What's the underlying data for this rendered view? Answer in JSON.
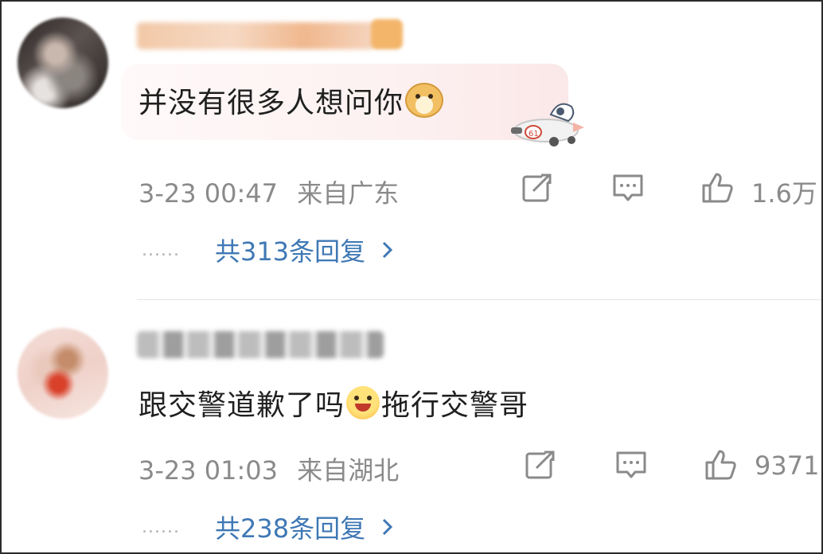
{
  "comments": [
    {
      "text": "并没有很多人想问你",
      "emoji": "doge-emoji",
      "timestamp": "3-23 00:47",
      "location": "来自广东",
      "like_count": "1.6万",
      "replies_label": "共313条回复",
      "ellipsis": "......"
    },
    {
      "text_before": "跟交警道歉了吗",
      "text_after": "拖行交警哥",
      "emoji": "grinning-emoji",
      "timestamp": "3-23 01:03",
      "location": "来自湖北",
      "like_count": "9371",
      "replies_label": "共238条回复",
      "ellipsis": "......"
    }
  ],
  "icons": {
    "share": "share-icon",
    "comment": "comment-icon",
    "like": "thumbs-up-icon",
    "chevron": "chevron-right-icon"
  },
  "colors": {
    "link": "#3f78b5",
    "meta": "#8a8a8a",
    "text": "#1f1f1f"
  }
}
